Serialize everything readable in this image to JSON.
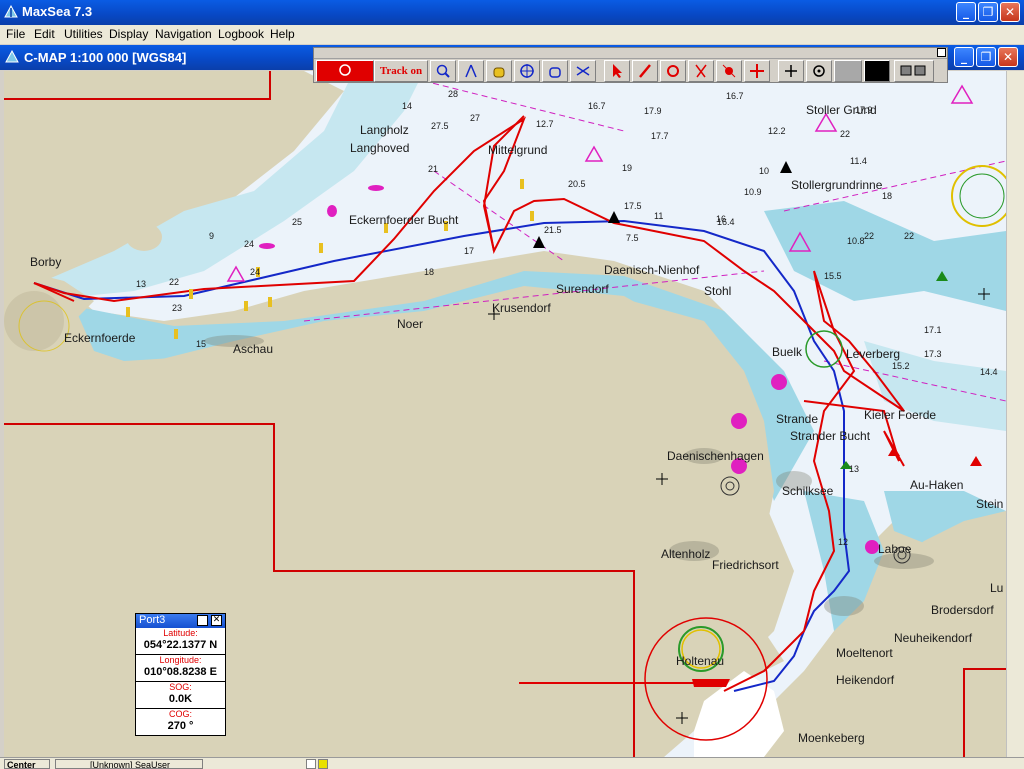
{
  "app": {
    "title": "MaxSea 7.3"
  },
  "window_buttons": {
    "minimize": "_",
    "restore": "❐",
    "close": "✕"
  },
  "menu": [
    "File",
    "Edit",
    "Utilities",
    "Display",
    "Navigation",
    "Logbook",
    "Help"
  ],
  "chart_window": {
    "title": "C-MAP  1:100 000 [WGS84]"
  },
  "toolbar": {
    "track_label": "Track on"
  },
  "places": [
    {
      "id": "langholz",
      "text": "Langholz"
    },
    {
      "id": "langhoved",
      "text": "Langhoved"
    },
    {
      "id": "mittelgrund",
      "text": "Mittelgrund"
    },
    {
      "id": "stoller-grund",
      "text": "Stoller Grund"
    },
    {
      "id": "stollergrundrinne",
      "text": "Stollergrundrinne"
    },
    {
      "id": "eckernfoerder-bucht",
      "text": "Eckernfoerder Bucht"
    },
    {
      "id": "borby",
      "text": "Borby"
    },
    {
      "id": "eckernfoerde",
      "text": "Eckernfoerde"
    },
    {
      "id": "aschau",
      "text": "Aschau"
    },
    {
      "id": "noer",
      "text": "Noer"
    },
    {
      "id": "krusendorf",
      "text": "Krusendorf"
    },
    {
      "id": "surendorf",
      "text": "Surendorf"
    },
    {
      "id": "daenisch-nienhof",
      "text": "Daenisch-Nienhof"
    },
    {
      "id": "stohl",
      "text": "Stohl"
    },
    {
      "id": "buelk",
      "text": "Buelk"
    },
    {
      "id": "leuchtturm",
      "text": "Leverberg"
    },
    {
      "id": "strande",
      "text": "Strande"
    },
    {
      "id": "kieler-foerde",
      "text": "Kieler Foerde"
    },
    {
      "id": "strander-bucht",
      "text": "Strander Bucht"
    },
    {
      "id": "daenischenhagen",
      "text": "Daenischenhagen"
    },
    {
      "id": "schilksee",
      "text": "Schilksee"
    },
    {
      "id": "au-haken",
      "text": "Au-Haken"
    },
    {
      "id": "stein",
      "text": "Stein"
    },
    {
      "id": "altenholz",
      "text": "Altenholz"
    },
    {
      "id": "friedrichsort",
      "text": "Friedrichsort"
    },
    {
      "id": "laboe",
      "text": "Laboe"
    },
    {
      "id": "lu",
      "text": "Lu"
    },
    {
      "id": "brodersdorf",
      "text": "Brodersdorf"
    },
    {
      "id": "neuheikendorf",
      "text": "Neuheikendorf"
    },
    {
      "id": "moeltenort",
      "text": "Moeltenort"
    },
    {
      "id": "heikendorf",
      "text": "Heikendorf"
    },
    {
      "id": "holtenau",
      "text": "Holtenau"
    },
    {
      "id": "moenkeberg",
      "text": "Moenkeberg"
    }
  ],
  "depths": [
    "28",
    "27",
    "27.5",
    "12.7",
    "16.7",
    "17.9",
    "16.7",
    "19",
    "17.7",
    "20.5",
    "21",
    "17.5",
    "22",
    "17.9",
    "16",
    "11.4",
    "12.2",
    "10.9",
    "7.5",
    "9",
    "14",
    "22",
    "24",
    "25",
    "22",
    "23",
    "17",
    "13",
    "15",
    "18",
    "21.5",
    "10",
    "11",
    "16.4",
    "15.5",
    "22",
    "18",
    "24",
    "17.1",
    "17.3",
    "15.2",
    "14.4",
    "10.8",
    "12",
    "13"
  ],
  "port_panel": {
    "title": "Port3",
    "latitude_label": "Latitude:",
    "latitude": "054°22.1377 N",
    "longitude_label": "Longitude:",
    "longitude": "010°08.8238 E",
    "sog_label": "SOG:",
    "sog": "0.0K",
    "cog_label": "COG:",
    "cog": "270 °"
  },
  "status": {
    "center": "Center Off",
    "user": "[Unknown] SeaUser"
  },
  "colors": {
    "land": "#d9d3b8",
    "shallow": "#9fd7e6",
    "mid": "#c6e7f0",
    "deep": "#ecf3fa",
    "route": "#e00000",
    "track": "#1428c8",
    "boundary": "#d00000"
  }
}
